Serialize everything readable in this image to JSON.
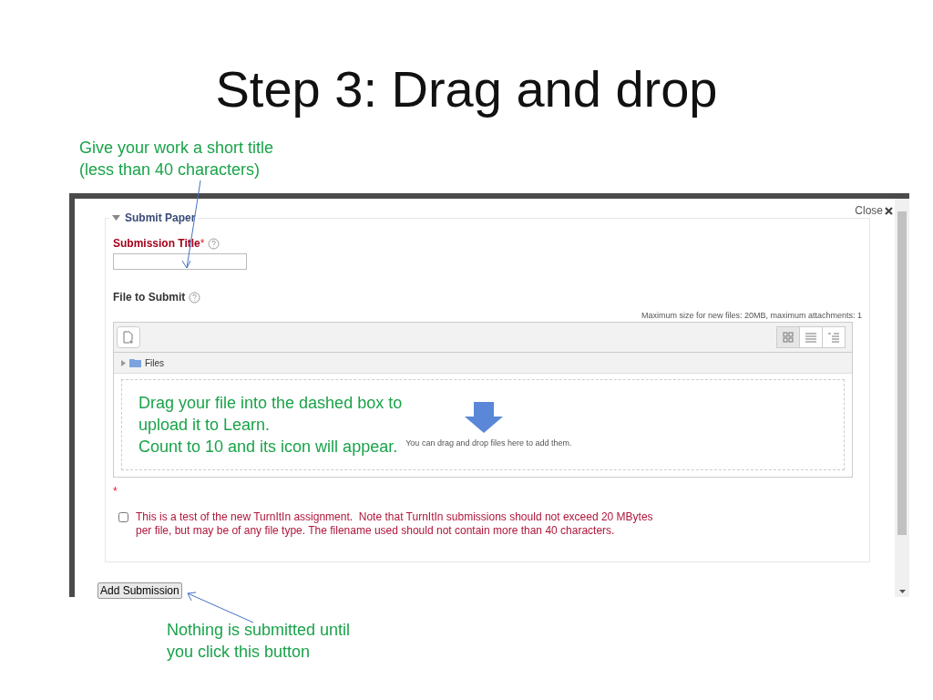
{
  "slide": {
    "title": "Step 3: Drag and drop"
  },
  "callout_top": [
    "Give your work a short title",
    "(less than 40 characters)"
  ],
  "dialog": {
    "close_label": "Close",
    "section": {
      "title": "Submit Paper",
      "expanded": true
    },
    "title_field": {
      "label": "Submission Title",
      "required": true
    },
    "file_field": {
      "label": "File to Submit",
      "note": "Maximum size for new files: 20MB, maximum attachments: 1",
      "views": [
        {
          "kind": "icons",
          "selected": true
        },
        {
          "kind": "list",
          "selected": false
        },
        {
          "kind": "tree",
          "selected": false
        }
      ],
      "folder": "Files",
      "drop_hint": "You can drag and drop files here to add them."
    },
    "callout_drop": [
      "Drag your file into the dashed box to",
      "upload it to Learn.",
      "Count to 10 and its icon will appear."
    ],
    "agreement": {
      "required_mark": "*",
      "checked": false,
      "lines": [
        "This is a test of the new TurnItIn assignment.  Note that TurnItIn submissions should not exceed 20 MBytes",
        "per file, but may be of any file type. The filename used should not contain more than 40 characters."
      ]
    },
    "submit_label": "Add Submission"
  },
  "callout_bottom": [
    "Nothing is submitted until",
    "you click this button"
  ]
}
